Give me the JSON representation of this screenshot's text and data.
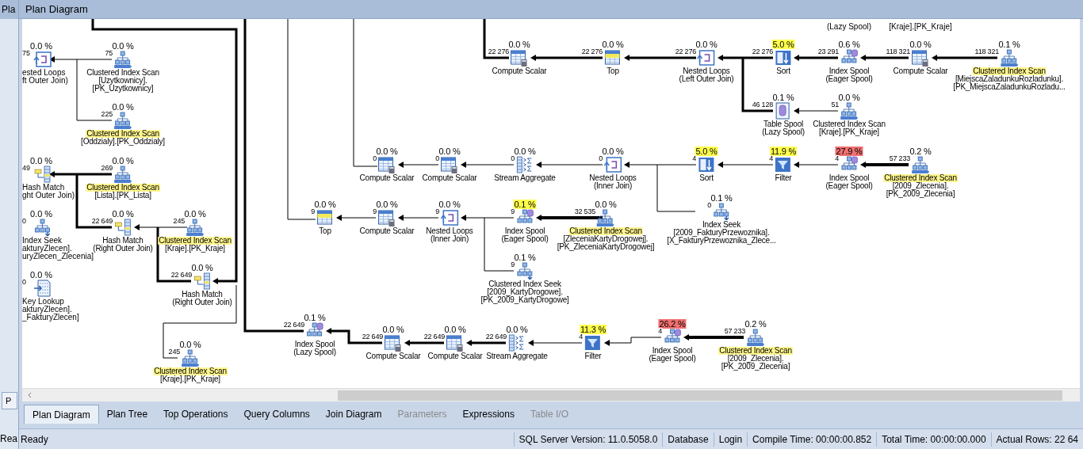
{
  "background_window": {
    "title": "Pla",
    "tab": "P",
    "status": "Rea"
  },
  "panel": {
    "title": "Plan Diagram"
  },
  "offscreen_labels": [
    "(Lazy Spool)",
    "[Kraje].[PK_Kraje]"
  ],
  "clipped_nodes": [
    {
      "cost": "0.0 %",
      "kind": "nested_loops",
      "rows": "75",
      "lines": [
        "ested Loops",
        "ft Outer Join)"
      ]
    },
    {
      "cost": "0.0 %",
      "kind": "hash_match",
      "rows": "49",
      "lines": [
        "Hash Match",
        "ght Outer Join)"
      ]
    },
    {
      "cost": "0.0 %",
      "kind": "seek",
      "rows": "0",
      "lines": [
        "Index Seek",
        "akturyZlecen].",
        "uryZlecen_Zlecenia]"
      ]
    },
    {
      "cost": "0.0 %",
      "kind": "key_lookup",
      "rows": "0",
      "lines": [
        "Key Lookup",
        "akturyZlecen].",
        "_FakturyZlecen]"
      ]
    }
  ],
  "nodes": [
    {
      "cost": "0.0 %",
      "cost_highlighted": false,
      "kind": "scan",
      "rows": "75",
      "name": "Clustered Index Scan",
      "name_highlighted": false,
      "details": [
        "[Uzytkownicy].",
        "[PK_Uzytkownicy]"
      ]
    },
    {
      "cost": "0.0 %",
      "cost_highlighted": false,
      "kind": "scan",
      "rows": "225",
      "name": "Clustered Index Scan",
      "name_highlighted": true,
      "details": [
        "[Oddzialy].[PK_Oddzialy]"
      ]
    },
    {
      "cost": "0.0 %",
      "cost_highlighted": false,
      "kind": "scan",
      "rows": "269",
      "name": "Clustered Index Scan",
      "name_highlighted": true,
      "details": [
        "[Lista].[PK_Lista]"
      ]
    },
    {
      "cost": "0.0 %",
      "cost_highlighted": false,
      "kind": "hash_match",
      "rows": "22 649",
      "name": "Hash Match",
      "name_highlighted": false,
      "details": [
        "(Right Outer Join)"
      ]
    },
    {
      "cost": "0.0 %",
      "cost_highlighted": false,
      "kind": "scan",
      "rows": "245",
      "name": "Clustered Index Scan",
      "name_highlighted": true,
      "details": [
        "[Kraje].[PK_Kraje]"
      ]
    },
    {
      "cost": "0.0 %",
      "cost_highlighted": false,
      "kind": "hash_match",
      "rows": "22 649",
      "name": "Hash Match",
      "name_highlighted": false,
      "details": [
        "(Right Outer Join)"
      ]
    },
    {
      "cost": "0.0 %",
      "cost_highlighted": false,
      "kind": "scan",
      "rows": "245",
      "name": "Clustered Index Scan",
      "name_highlighted": true,
      "details": [
        "[Kraje].[PK_Kraje]"
      ]
    },
    {
      "cost": "0.0 %",
      "cost_highlighted": false,
      "kind": "compute_scalar",
      "rows": "22 276",
      "name": "Compute Scalar",
      "name_highlighted": false
    },
    {
      "cost": "0.0 %",
      "cost_highlighted": false,
      "kind": "top",
      "rows": "22 276",
      "name": "Top",
      "name_highlighted": false
    },
    {
      "cost": "0.0 %",
      "cost_highlighted": false,
      "kind": "nested_loops",
      "rows": "22 276",
      "name": "Nested Loops",
      "name_highlighted": false,
      "details": [
        "(Left Outer Join)"
      ]
    },
    {
      "cost": "5.0 %",
      "cost_highlighted": true,
      "color": "#ffff4d",
      "kind": "sort",
      "rows": "22 276",
      "name": "Sort",
      "name_highlighted": false
    },
    {
      "cost": "0.6 %",
      "cost_highlighted": false,
      "kind": "index_spool",
      "rows": "23 291",
      "name": "Index Spool",
      "name_highlighted": false,
      "details": [
        "(Eager Spool)"
      ]
    },
    {
      "cost": "0.0 %",
      "cost_highlighted": false,
      "kind": "compute_scalar",
      "rows": "118 321",
      "name": "Compute Scalar",
      "name_highlighted": false
    },
    {
      "cost": "0.1 %",
      "cost_highlighted": false,
      "kind": "scan",
      "rows": "118 321",
      "name": "Clustered Index Scan",
      "name_highlighted": true,
      "details": [
        "[MiejscaZaladunkuRozladunku].",
        "[PK_MiejscaZaladunkuRozladu..."
      ]
    },
    {
      "cost": "0.1 %",
      "cost_highlighted": false,
      "kind": "table_spool",
      "rows": "46 128",
      "name": "Table Spool",
      "name_highlighted": false,
      "details": [
        "(Lazy Spool)"
      ]
    },
    {
      "cost": "0.0 %",
      "cost_highlighted": false,
      "kind": "scan",
      "rows": "51",
      "name": "Clustered Index Scan",
      "name_highlighted": false,
      "details": [
        "[Kraje].[PK_Kraje]"
      ]
    },
    {
      "cost": "0.0 %",
      "cost_highlighted": false,
      "kind": "compute_scalar",
      "rows": "0",
      "name": "Compute Scalar",
      "name_highlighted": false
    },
    {
      "cost": "0.0 %",
      "cost_highlighted": false,
      "kind": "compute_scalar",
      "rows": "0",
      "name": "Compute Scalar",
      "name_highlighted": false
    },
    {
      "cost": "0.0 %",
      "cost_highlighted": false,
      "kind": "stream_aggregate",
      "rows": "0",
      "name": "Stream Aggregate",
      "name_highlighted": false
    },
    {
      "cost": "0.0 %",
      "cost_highlighted": false,
      "kind": "nested_loops",
      "rows": "0",
      "name": "Nested Loops",
      "name_highlighted": false,
      "details": [
        "(Inner Join)"
      ]
    },
    {
      "cost": "5.0 %",
      "cost_highlighted": true,
      "color": "#ffff4d",
      "kind": "sort",
      "rows": "4",
      "name": "Sort",
      "name_highlighted": false
    },
    {
      "cost": "11.9 %",
      "cost_highlighted": true,
      "color": "#ffff4d",
      "kind": "filter",
      "rows": "4",
      "name": "Filter",
      "name_highlighted": false
    },
    {
      "cost": "27.9 %",
      "cost_highlighted": true,
      "color": "#f07070",
      "kind": "index_spool",
      "rows": "4",
      "name": "Index Spool",
      "name_highlighted": false,
      "details": [
        "(Eager Spool)"
      ]
    },
    {
      "cost": "0.2 %",
      "cost_highlighted": false,
      "kind": "scan",
      "rows": "57 233",
      "name": "Clustered Index Scan",
      "name_highlighted": true,
      "details": [
        "[2009_Zlecenia].",
        "[PK_2009_Zlecenia]"
      ]
    },
    {
      "cost": "0.0 %",
      "cost_highlighted": false,
      "kind": "top",
      "rows": "9",
      "name": "Top",
      "name_highlighted": false
    },
    {
      "cost": "0.0 %",
      "cost_highlighted": false,
      "kind": "compute_scalar",
      "rows": "9",
      "name": "Compute Scalar",
      "name_highlighted": false
    },
    {
      "cost": "0.0 %",
      "cost_highlighted": false,
      "kind": "nested_loops",
      "rows": "9",
      "name": "Nested Loops",
      "name_highlighted": false,
      "details": [
        "(Inner Join)"
      ]
    },
    {
      "cost": "0.1 %",
      "cost_highlighted": true,
      "color": "#ffff4d",
      "kind": "index_spool",
      "rows": "9",
      "name": "Index Spool",
      "name_highlighted": false,
      "details": [
        "(Eager Spool)"
      ]
    },
    {
      "cost": "0.0 %",
      "cost_highlighted": false,
      "kind": "scan",
      "rows": "32 535",
      "name": "Clustered Index Scan",
      "name_highlighted": true,
      "details": [
        "[ZleceniaKartyDrogowej].",
        "[PK_ZleceniaKartyDrogowej]"
      ]
    },
    {
      "cost": "0.1 %",
      "cost_highlighted": false,
      "kind": "seek",
      "rows": "0",
      "name": "Index Seek",
      "name_highlighted": false,
      "details": [
        "[2009_FakturyPrzewoznika].",
        "[X_FakturyPrzewoznika_Zlece..."
      ]
    },
    {
      "cost": "0.1 %",
      "cost_highlighted": false,
      "kind": "seek",
      "rows": "9",
      "name": "Clustered Index Seek",
      "name_highlighted": false,
      "details": [
        "[2009_KartyDrogowe].",
        "[PK_2009_KartyDrogowe]"
      ]
    },
    {
      "cost": "0.1 %",
      "cost_highlighted": false,
      "kind": "index_spool",
      "rows": "22 649",
      "name": "Index Spool",
      "name_highlighted": false,
      "details": [
        "(Lazy Spool)"
      ]
    },
    {
      "cost": "0.0 %",
      "cost_highlighted": false,
      "kind": "compute_scalar",
      "rows": "22 649",
      "name": "Compute Scalar",
      "name_highlighted": false
    },
    {
      "cost": "0.0 %",
      "cost_highlighted": false,
      "kind": "compute_scalar",
      "rows": "22 649",
      "name": "Compute Scalar",
      "name_highlighted": false
    },
    {
      "cost": "0.0 %",
      "cost_highlighted": false,
      "kind": "stream_aggregate",
      "rows": "22 649",
      "name": "Stream Aggregate",
      "name_highlighted": false
    },
    {
      "cost": "11.3 %",
      "cost_highlighted": true,
      "color": "#ffff4d",
      "kind": "filter",
      "rows": "4",
      "name": "Filter",
      "name_highlighted": false
    },
    {
      "cost": "26.2 %",
      "cost_highlighted": true,
      "color": "#f07070",
      "kind": "index_spool",
      "rows": "4",
      "name": "Index Spool",
      "name_highlighted": false,
      "details": [
        "(Eager Spool)"
      ]
    },
    {
      "cost": "0.2 %",
      "cost_highlighted": false,
      "kind": "scan",
      "rows": "57 233",
      "name": "Clustered Index Scan",
      "name_highlighted": true,
      "details": [
        "[2009_Zlecenia].",
        "[PK_2009_Zlecenia]"
      ]
    }
  ],
  "tabs": [
    {
      "label": "Plan Diagram",
      "selected": true,
      "disabled": false
    },
    {
      "label": "Plan Tree",
      "selected": false,
      "disabled": false
    },
    {
      "label": "Top Operations",
      "selected": false,
      "disabled": false
    },
    {
      "label": "Query Columns",
      "selected": false,
      "disabled": false
    },
    {
      "label": "Join Diagram",
      "selected": false,
      "disabled": false
    },
    {
      "label": "Parameters",
      "selected": false,
      "disabled": true
    },
    {
      "label": "Expressions",
      "selected": false,
      "disabled": false
    },
    {
      "label": "Table I/O",
      "selected": false,
      "disabled": true
    }
  ],
  "status_bar": {
    "state": "Ready",
    "items": [
      "SQL Server Version: 11.0.5058.0",
      "Database",
      "Login",
      "Compile Time: 00:00:00.852",
      "Total Time: 00:00:00.000",
      "Actual Rows: 22 64"
    ]
  }
}
